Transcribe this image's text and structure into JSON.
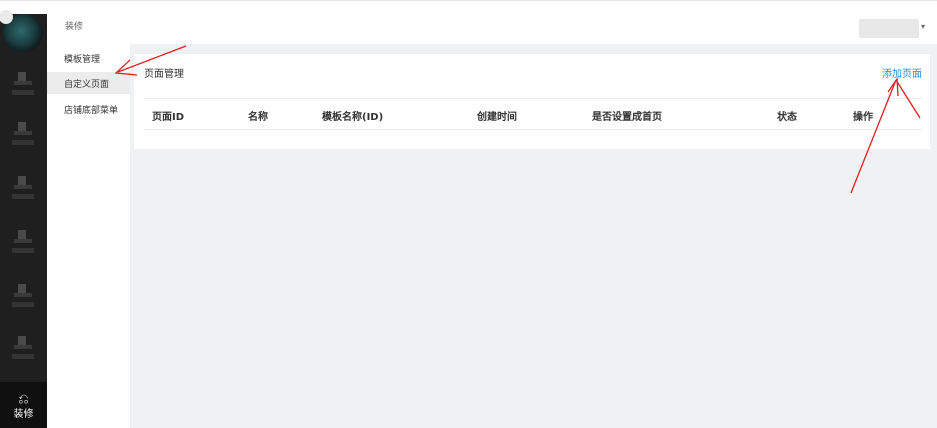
{
  "rail": {
    "active_item": {
      "icon": "⎌",
      "label": "装修"
    }
  },
  "submenu": {
    "title": "装修",
    "items": [
      {
        "label": "模板管理"
      },
      {
        "label": "自定义页面"
      },
      {
        "label": "店铺底部菜单"
      }
    ]
  },
  "panel": {
    "title": "页面管理",
    "add_link": "添加页面"
  },
  "table": {
    "columns": [
      "页面ID",
      "名称",
      "模板名称(ID)",
      "创建时间",
      "是否设置成首页",
      "状态",
      "操作"
    ]
  },
  "colors": {
    "accent": "#1a8fe3",
    "rail": "#1f1f1f",
    "annotation": "#e02020"
  }
}
